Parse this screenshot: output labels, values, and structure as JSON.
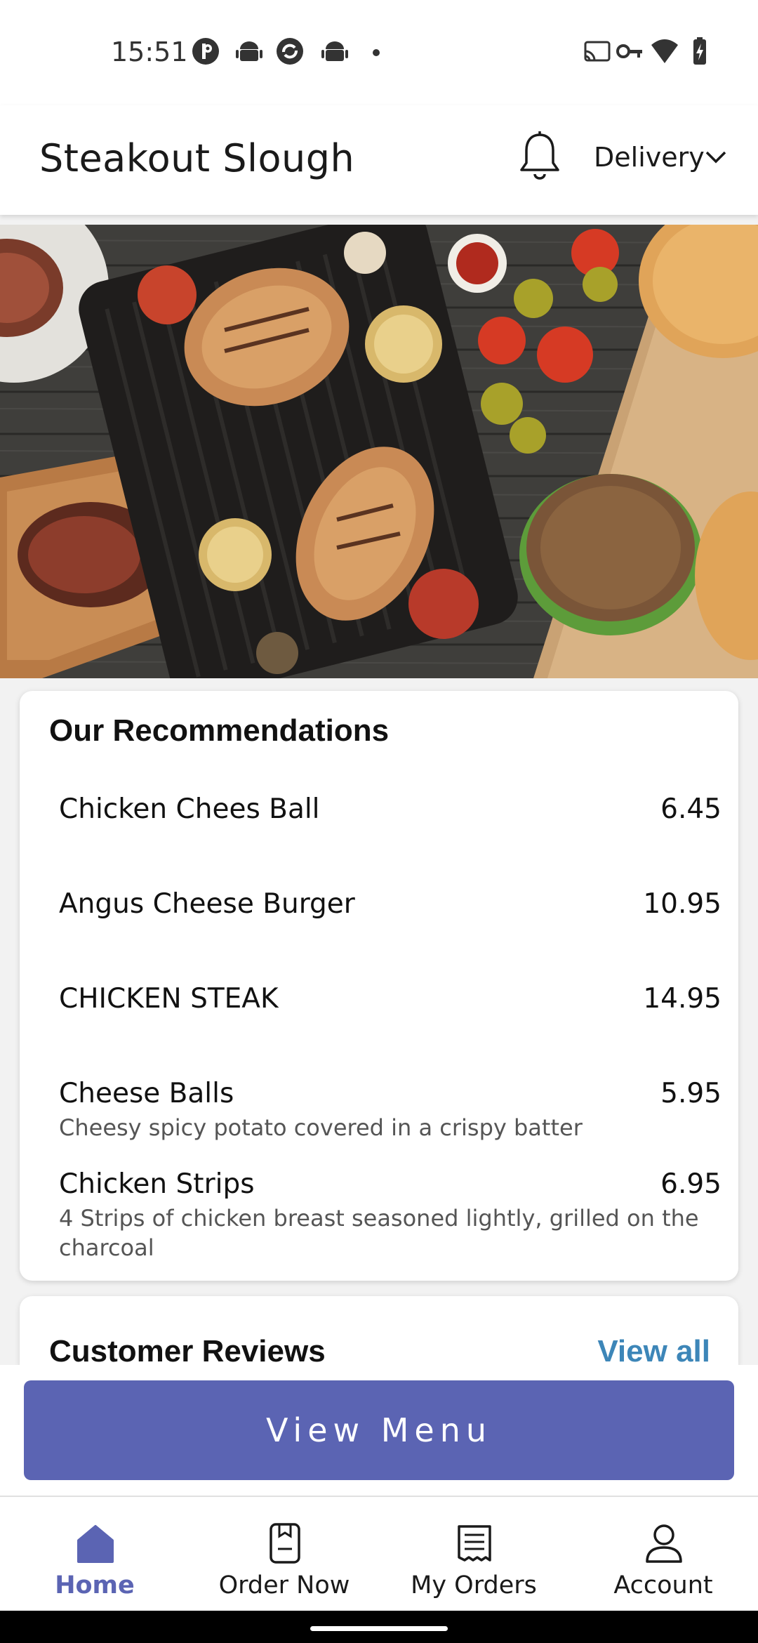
{
  "status_bar": {
    "time": "15:51",
    "left_icons": [
      "p-icon",
      "android-icon",
      "sync-icon",
      "android-icon",
      "dot-icon"
    ],
    "right_icons": [
      "cast-icon",
      "vpn-key-icon",
      "wifi-icon",
      "battery-charging-icon"
    ]
  },
  "header": {
    "title": "Steakout Slough",
    "notification_icon": "bell-icon",
    "order_type": "Delivery",
    "order_type_icon": "chevron-down-icon"
  },
  "recommendations": {
    "title": "Our Recommendations",
    "items": [
      {
        "name": "Chicken Chees Ball",
        "price": "6.45",
        "description": ""
      },
      {
        "name": "Angus Cheese Burger",
        "price": "10.95",
        "description": ""
      },
      {
        "name": "CHICKEN STEAK",
        "price": "14.95",
        "description": ""
      },
      {
        "name": "Cheese Balls",
        "price": "5.95",
        "description": "Cheesy spicy potato covered in a crispy batter"
      },
      {
        "name": "Chicken Strips",
        "price": "6.95",
        "description": "4 Strips of chicken breast seasoned lightly, grilled on the charcoal"
      }
    ]
  },
  "reviews": {
    "title": "Customer Reviews",
    "view_all": "View all"
  },
  "view_menu_button": "View Menu",
  "bottom_nav": [
    {
      "label": "Home",
      "icon": "home-icon",
      "active": true
    },
    {
      "label": "Order Now",
      "icon": "order-now-icon",
      "active": false
    },
    {
      "label": "My Orders",
      "icon": "receipt-icon",
      "active": false
    },
    {
      "label": "Account",
      "icon": "account-icon",
      "active": false
    }
  ],
  "colors": {
    "accent": "#5b64b3",
    "link": "#3d86b8"
  }
}
